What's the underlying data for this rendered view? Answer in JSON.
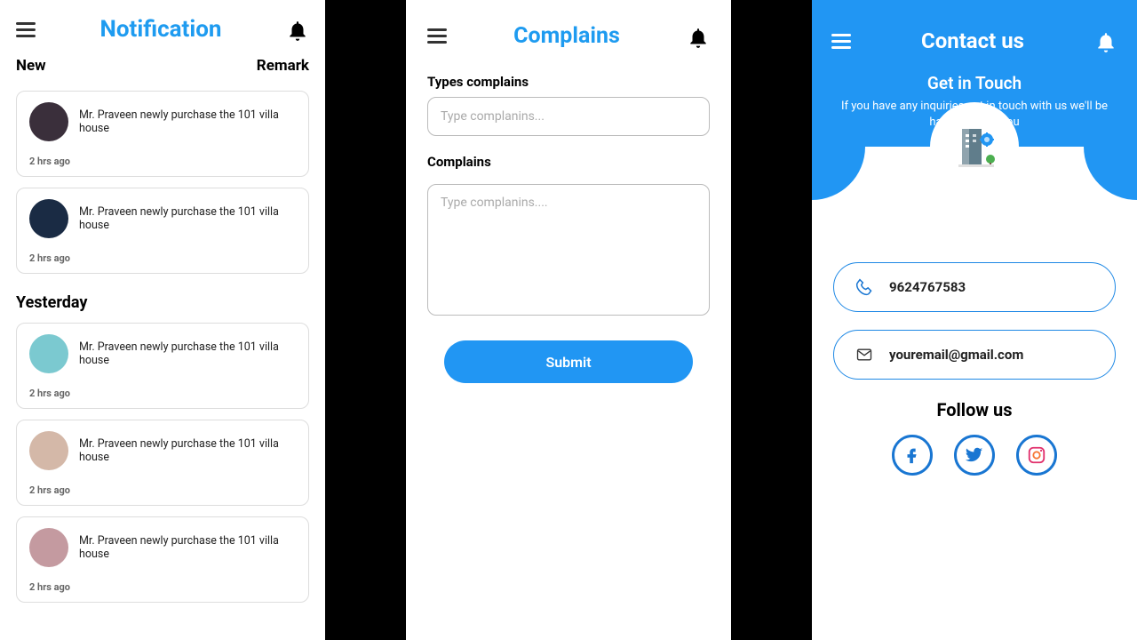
{
  "s1": {
    "title": "Notification",
    "new": "New",
    "remark": "Remark",
    "yesterday": "Yesterday",
    "msg": "Mr. Praveen newly purchase the 101 villa house",
    "time": "2 hrs ago",
    "avatars": [
      "#3a2f3b",
      "#1a2b44",
      "#7bc9d0",
      "#d4b8a8",
      "#c49aa0"
    ]
  },
  "s2": {
    "title": "Complains",
    "types_label": "Types complains",
    "types_ph": "Type complanins...",
    "comp_label": "Complains",
    "comp_ph": "Type complanins....",
    "submit": "Submit"
  },
  "s3": {
    "title": "Contact us",
    "sub1": "Get in Touch",
    "sub2": "If you have any inquiries get in touch with us we'll be happy to help you",
    "phone": "9624767583",
    "email": "youremail@gmail.com",
    "follow": "Follow us"
  }
}
